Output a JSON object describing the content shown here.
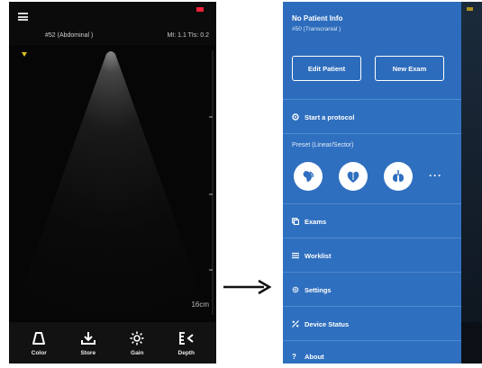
{
  "left_screen": {
    "preset_label": "#52 (Abdominal )",
    "mi_tis": "MI: 1.1 TIs: 0.2",
    "depth": "16cm",
    "toolbar": [
      {
        "label": "Color",
        "icon": "color-probe-icon"
      },
      {
        "label": "Store",
        "icon": "store-download-icon"
      },
      {
        "label": "Gain",
        "icon": "gain-brightness-icon"
      },
      {
        "label": "Depth",
        "icon": "depth-icon"
      }
    ]
  },
  "right_screen": {
    "patient_title": "No Patient Info",
    "patient_subtitle": "#50 (Transcranial )",
    "edit_patient_label": "Edit Patient",
    "new_exam_label": "New Exam",
    "start_protocol_label": "Start a protocol",
    "preset_section_label": "Preset (Linear/Sector)",
    "presets": [
      {
        "icon": "abdominal-preset-icon"
      },
      {
        "icon": "cardiac-preset-icon"
      },
      {
        "icon": "lung-preset-icon"
      }
    ],
    "more_label": "···",
    "menu": [
      {
        "label": "Exams",
        "icon": "exams-icon"
      },
      {
        "label": "Worklist",
        "icon": "worklist-icon"
      },
      {
        "label": "Settings",
        "icon": "settings-icon"
      },
      {
        "label": "Device Status",
        "icon": "device-status-icon"
      },
      {
        "label": "About",
        "icon": "about-icon"
      }
    ]
  },
  "colors": {
    "drawer_blue": "#2f6fbf",
    "scan_black": "#060606",
    "focus_marker": "#e0c020",
    "battery_red": "#e23344"
  }
}
